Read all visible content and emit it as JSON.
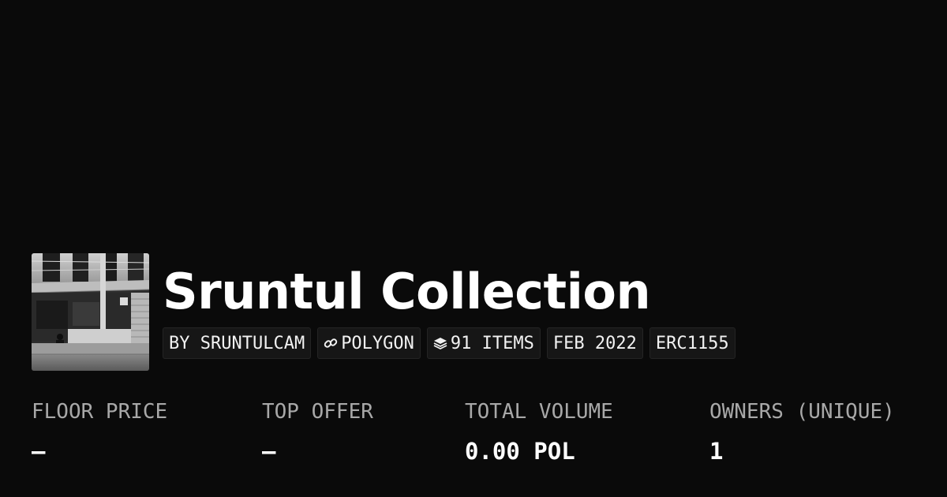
{
  "collection": {
    "name": "Sruntul Collection",
    "avatar_alt": "Black and white photo of a person sitting in front of a storefront"
  },
  "tags": {
    "creator": "BY SRUNTULCAM",
    "chain": "POLYGON",
    "chain_icon": "link-icon",
    "items": "91 ITEMS",
    "items_icon": "layers-icon",
    "date": "FEB 2022",
    "standard": "ERC1155"
  },
  "stats": [
    {
      "label": "FLOOR PRICE",
      "value": "–"
    },
    {
      "label": "TOP OFFER",
      "value": "–"
    },
    {
      "label": "TOTAL VOLUME",
      "value": "0.00 POL"
    },
    {
      "label": "OWNERS (UNIQUE)",
      "value": "1"
    }
  ],
  "colors": {
    "background": "#0a0a0a",
    "text": "#ffffff",
    "muted": "#a8a8a8",
    "chip_bg": "#161616",
    "chip_border": "#242424"
  }
}
